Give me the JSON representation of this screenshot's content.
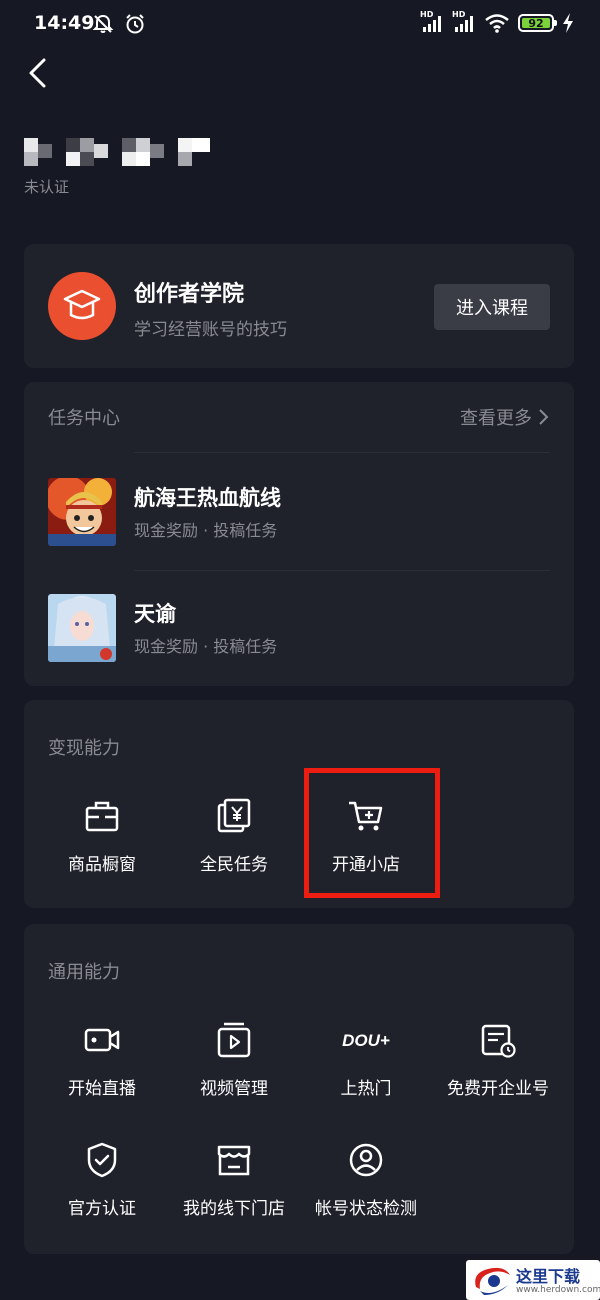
{
  "status_bar": {
    "time": "14:49",
    "battery_level": "92",
    "network_labels": [
      "HD",
      "HD"
    ],
    "icons": [
      "bell-off-icon",
      "alarm-icon",
      "signal-icon",
      "signal-icon",
      "wifi-icon",
      "battery-icon",
      "charging-icon"
    ]
  },
  "header": {
    "back_icon": "chevron-left-icon"
  },
  "user": {
    "status": "未认证"
  },
  "academy": {
    "title": "创作者学院",
    "subtitle": "学习经营账号的技巧",
    "button_label": "进入课程",
    "icon": "graduation-cap-icon",
    "accent": "#EA4F2F"
  },
  "tasks": {
    "title": "任务中心",
    "more_label": "查看更多",
    "items": [
      {
        "name": "航海王热血航线",
        "desc": "现金奖励 · 投稿任务"
      },
      {
        "name": "天谕",
        "desc": "现金奖励 · 投稿任务"
      }
    ]
  },
  "monetize": {
    "title": "变现能力",
    "items": [
      {
        "label": "商品橱窗",
        "icon": "showcase-icon"
      },
      {
        "label": "全民任务",
        "icon": "yuan-task-icon"
      },
      {
        "label": "开通小店",
        "icon": "shopping-cart-add-icon"
      }
    ],
    "highlight_color": "#EE1D12"
  },
  "general": {
    "title": "通用能力",
    "items": [
      {
        "label": "开始直播",
        "icon": "camera-icon"
      },
      {
        "label": "视频管理",
        "icon": "video-manage-icon"
      },
      {
        "label": "上热门",
        "icon": "dou-plus-icon",
        "icon_text": "DOU+"
      },
      {
        "label": "免费开企业号",
        "icon": "enterprise-icon"
      },
      {
        "label": "官方认证",
        "icon": "shield-check-icon"
      },
      {
        "label": "我的线下门店",
        "icon": "store-icon"
      },
      {
        "label": "帐号状态检测",
        "icon": "user-check-icon"
      }
    ]
  },
  "watermark": {
    "text": "这里下载",
    "url": "www.herdown.com"
  },
  "colors": {
    "background": "#161823",
    "card": "#1F212B",
    "muted_text": "#8A8B91"
  }
}
